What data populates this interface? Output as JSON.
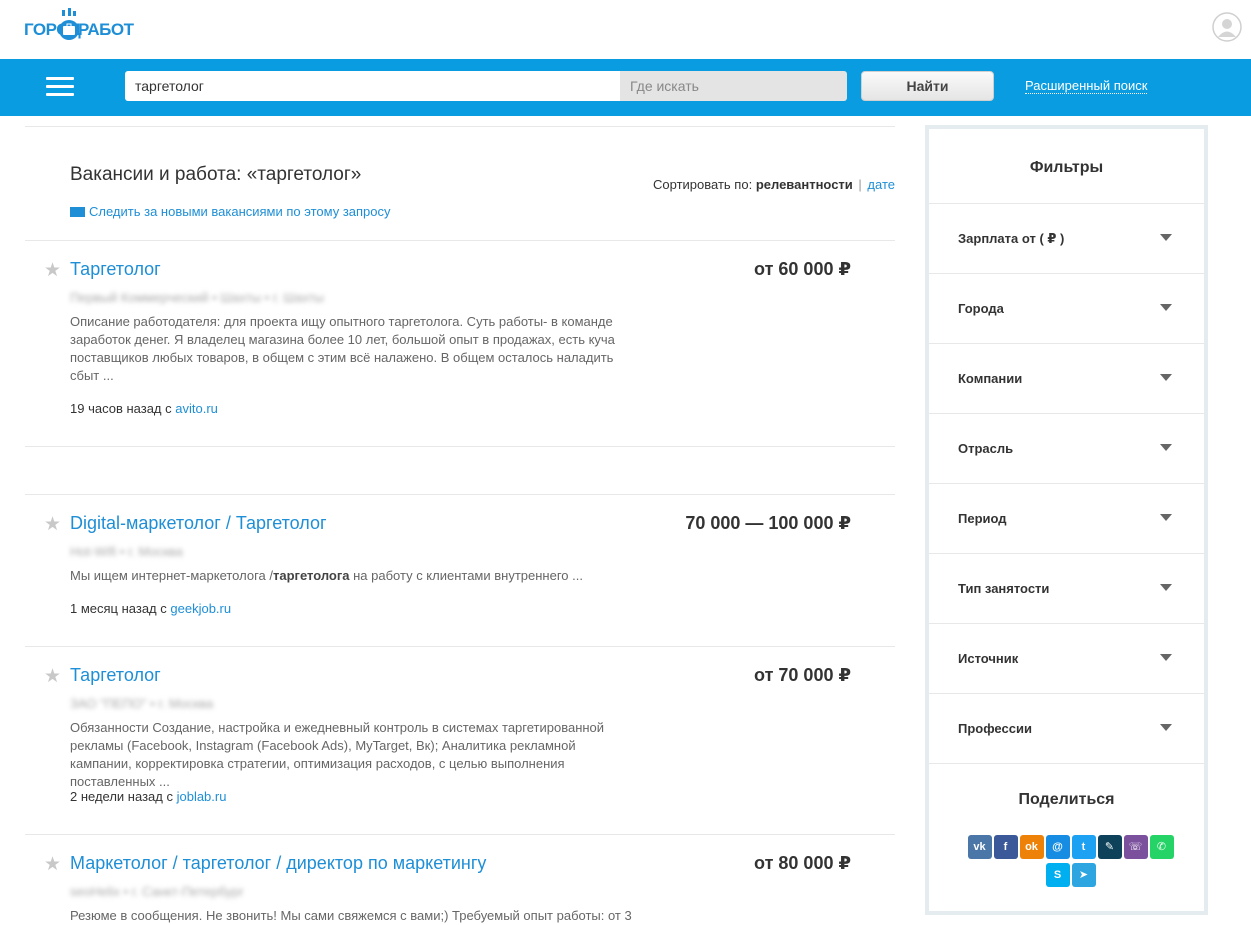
{
  "header": {
    "logo": {
      "part1": "ГОРОД",
      "part2": "РАБОТ"
    },
    "user_icon": "user-icon"
  },
  "search": {
    "menu_icon": "hamburger-icon",
    "query_value": "таргетолог",
    "where_placeholder": "Где искать",
    "find_label": "Найти",
    "advanced_label": "Расширенный поиск",
    "accent_color": "#0a9ce0"
  },
  "results": {
    "title": "Вакансии и работа: «таргетолог»",
    "sort_label": "Сортировать по:",
    "sort_active": "релевантности",
    "sort_separator": "|",
    "sort_alt": "дате",
    "subscribe_label": "Следить за новыми вакансиями по этому запросу",
    "jobs": [
      {
        "title": "Таргетолог",
        "salary": "от 60 000 ₽",
        "company": "Первый Коммерческий • Шахты • г. Шахты",
        "desc_plain": "Описание работодателя: для проекта ищу опытного таргетолога. Суть работы- в команде заработок денег. Я владелец магазина более 10 лет, большой опыт в продажах, есть куча поставщиков любых товаров, в общем с этим всё налажено. В общем осталось наладить сбыт ...",
        "time": "19 часов назад с",
        "source": "avito.ru"
      },
      {
        "title": "Digital-маркетолог / Таргетолог",
        "salary": "70 000 — 100 000 ₽",
        "company": "Hot-Wifi • г. Москва",
        "desc_before": "Мы ищем интернет-маркетолога /",
        "desc_bold": "таргетолога",
        "desc_after": " на работу с клиентами внутреннего ...",
        "time": "1 месяц назад с",
        "source": "geekjob.ru"
      },
      {
        "title": "Таргетолог",
        "salary": "от 70 000 ₽",
        "company": "ЗАО \"ПЕПО\" • г. Москва",
        "desc_plain": "Обязанности Создание, настройка и ежедневный контроль в системах таргетированной рекламы (Facebook, Instagram (Facebook Ads), MyTarget, Вк); Аналитика рекламной кампании, корректировка стратегии, оптимизация расходов, с целью выполнения поставленных ...",
        "time": "2 недели назад с",
        "source": "joblab.ru"
      },
      {
        "title": "Маркетолог / таргетолог / директор по маркетингу",
        "salary": "от 80 000 ₽",
        "company": "seoHelix • г. Санкт-Петербург",
        "desc_plain": "Резюме в сообщения. Не звонить! Мы сами свяжемся с вами;) Требуемый опыт работы: от 3"
      }
    ]
  },
  "sidebar": {
    "title": "Фильтры",
    "filters": [
      "Зарплата от ( ₽ )",
      "Города",
      "Компании",
      "Отрасль",
      "Период",
      "Тип занятости",
      "Источник",
      "Профессии"
    ],
    "share_title": "Поделиться",
    "share_icons": [
      {
        "name": "vk-icon",
        "glyph": "vk",
        "color": "#4a76a8"
      },
      {
        "name": "facebook-icon",
        "glyph": "f",
        "color": "#3b5998"
      },
      {
        "name": "odnoklassniki-icon",
        "glyph": "ok",
        "color": "#ee8208"
      },
      {
        "name": "mailru-icon",
        "glyph": "@",
        "color": "#168de2"
      },
      {
        "name": "twitter-icon",
        "glyph": "t",
        "color": "#1da1f2"
      },
      {
        "name": "livejournal-icon",
        "glyph": "✎",
        "color": "#0d425a"
      },
      {
        "name": "viber-icon",
        "glyph": "☏",
        "color": "#7b519d"
      },
      {
        "name": "whatsapp-icon",
        "glyph": "✆",
        "color": "#25d366"
      },
      {
        "name": "skype-icon",
        "glyph": "S",
        "color": "#00aff0"
      },
      {
        "name": "telegram-icon",
        "glyph": "➤",
        "color": "#2ca5e0"
      }
    ]
  }
}
